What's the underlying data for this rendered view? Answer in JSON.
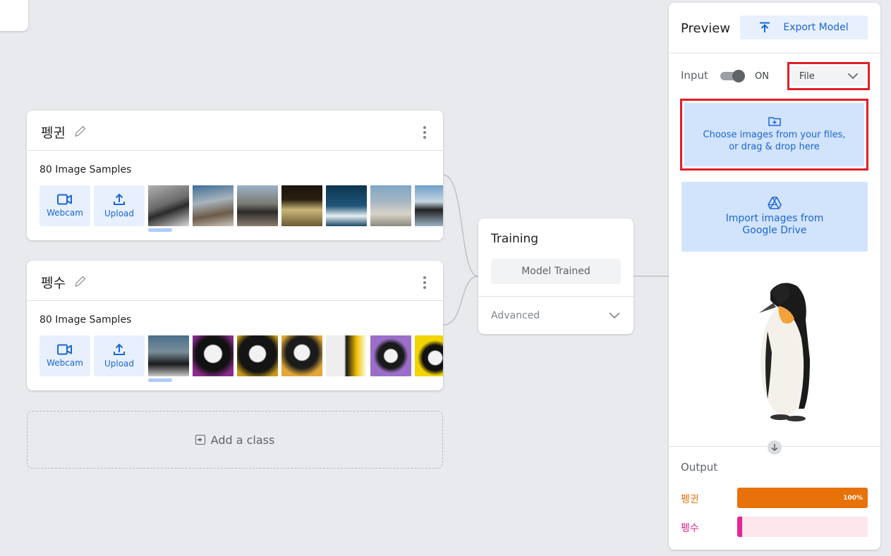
{
  "classes": [
    {
      "name": "펭귄",
      "samples": "80 Image Samples",
      "webcam": "Webcam",
      "upload": "Upload"
    },
    {
      "name": "펭수",
      "samples": "80 Image Samples",
      "webcam": "Webcam",
      "upload": "Upload"
    }
  ],
  "add_class": "Add a class",
  "training": {
    "title": "Training",
    "status": "Model Trained",
    "advanced": "Advanced"
  },
  "preview": {
    "title": "Preview",
    "export": "Export Model",
    "input_label": "Input",
    "toggle_state": "ON",
    "source": "File",
    "choose_line1": "Choose images from your files,",
    "choose_line2": "or drag & drop here",
    "drive_line1": "Import images from",
    "drive_line2": "Google Drive",
    "output_label": "Output"
  },
  "output": [
    {
      "label": "펭귄",
      "value": 100,
      "text": "100%",
      "color": "#e8710a",
      "bg": "#fde7d2"
    },
    {
      "label": "펭수",
      "value": 0,
      "text": "",
      "color": "#e52592",
      "bg": "#fde7ec"
    }
  ],
  "icons": [
    "pencil-icon",
    "more-vert-icon",
    "webcam-icon",
    "upload-icon",
    "export-icon",
    "chevron-down-icon",
    "folder-add-icon",
    "google-drive-icon",
    "arrow-down-icon",
    "add-box-icon"
  ],
  "colors": {
    "accent": "#1967d2",
    "accent_light": "#e8f0fe",
    "highlight": "#e11e26"
  }
}
